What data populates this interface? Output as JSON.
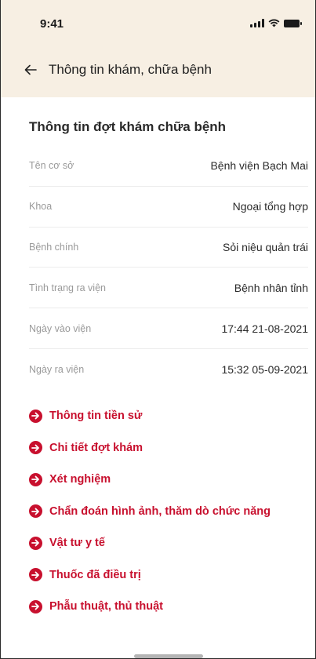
{
  "status_bar": {
    "time": "9:41"
  },
  "nav": {
    "title": "Thông tin khám, chữa bệnh"
  },
  "section": {
    "title": "Thông tin đợt khám chữa bệnh"
  },
  "info_rows": [
    {
      "label": "Tên cơ sở",
      "value": "Bệnh viện Bạch Mai"
    },
    {
      "label": "Khoa",
      "value": "Ngoại tổng hợp"
    },
    {
      "label": "Bệnh chính",
      "value": "Sỏi niệu quản trái"
    },
    {
      "label": "Tình trạng ra viện",
      "value": "Bệnh nhân tỉnh"
    },
    {
      "label": "Ngày vào viện",
      "value": "17:44 21-08-2021"
    },
    {
      "label": "Ngày ra viện",
      "value": "15:32 05-09-2021"
    }
  ],
  "links": [
    {
      "label": "Thông tin tiền sử",
      "icon": "arrow-right-circle-icon"
    },
    {
      "label": "Chi tiết đợt khám",
      "icon": "arrow-right-circle-icon"
    },
    {
      "label": "Xét nghiệm",
      "icon": "arrow-right-circle-icon"
    },
    {
      "label": "Chẩn đoán hình ảnh, thăm dò chức năng",
      "icon": "arrow-right-circle-icon"
    },
    {
      "label": "Vật tư y tế",
      "icon": "arrow-right-circle-icon"
    },
    {
      "label": "Thuốc đã điều trị",
      "icon": "arrow-right-circle-icon"
    },
    {
      "label": "Phẫu thuật, thủ thuật",
      "icon": "arrow-right-circle-icon"
    }
  ],
  "colors": {
    "header_bg": "#f7efe3",
    "accent": "#c8102e",
    "label_gray": "#9a9a9a"
  }
}
